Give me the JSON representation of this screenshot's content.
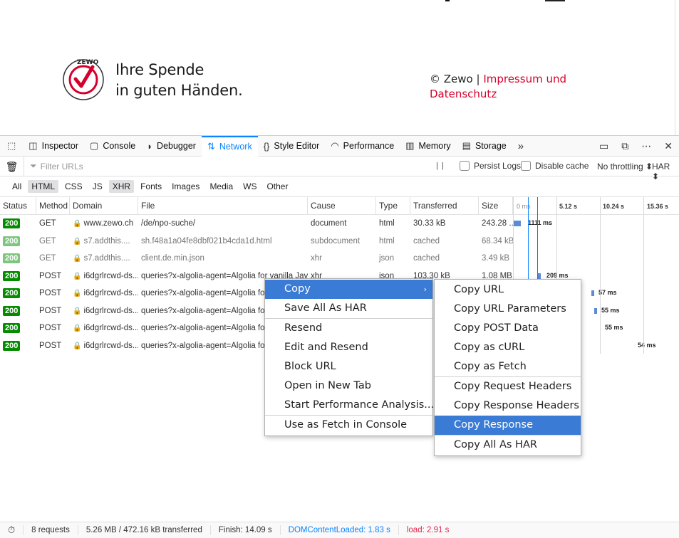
{
  "page": {
    "logo_text_line1": "Ihre Spende",
    "logo_text_line2": "in guten Händen.",
    "logo_seal_text": "ZEWO",
    "copyright": "© Zewo | ",
    "impressum_link": "Impressum und",
    "datenschutz_link": "Datenschutz"
  },
  "toolbar": {
    "tabs": [
      {
        "label": "Inspector",
        "icon": "inspector-icon"
      },
      {
        "label": "Console",
        "icon": "console-icon"
      },
      {
        "label": "Debugger",
        "icon": "debugger-icon"
      },
      {
        "label": "Network",
        "icon": "network-icon"
      },
      {
        "label": "Style Editor",
        "icon": "style-editor-icon"
      },
      {
        "label": "Performance",
        "icon": "performance-icon"
      },
      {
        "label": "Memory",
        "icon": "memory-icon"
      },
      {
        "label": "Storage",
        "icon": "storage-icon"
      }
    ],
    "active": "Network"
  },
  "filter": {
    "placeholder": "Filter URLs",
    "persist_logs": "Persist Logs",
    "disable_cache": "Disable cache",
    "throttling": "No throttling ⬍",
    "har": "HAR ⬍"
  },
  "types": [
    "All",
    "HTML",
    "CSS",
    "JS",
    "XHR",
    "Fonts",
    "Images",
    "Media",
    "WS",
    "Other"
  ],
  "columns": [
    "Status",
    "Method",
    "Domain",
    "File",
    "Cause",
    "Type",
    "Transferred",
    "Size"
  ],
  "waterfall_ticks": [
    "0 ms",
    "5.12 s",
    "10.24 s",
    "15.36 s"
  ],
  "rows": [
    {
      "status": "200",
      "method": "GET",
      "domain": "www.zewo.ch",
      "file": "/de/npo-suche/",
      "cause": "document",
      "type": "html",
      "transferred": "30.33 kB",
      "size": "243.28 ...",
      "wf": "1111 ms",
      "cached": false
    },
    {
      "status": "200",
      "method": "GET",
      "domain": "s7.addthis....",
      "file": "sh.f48a1a04fe8dbf021b4cda1d.html",
      "cause": "subdocument",
      "type": "html",
      "transferred": "cached",
      "size": "68.34 kB",
      "wf": "",
      "cached": true
    },
    {
      "status": "200",
      "method": "GET",
      "domain": "s7.addthis....",
      "file": "client.de.min.json",
      "cause": "xhr",
      "type": "json",
      "transferred": "cached",
      "size": "3.49 kB",
      "wf": "",
      "cached": true
    },
    {
      "status": "200",
      "method": "POST",
      "domain": "i6dgrlrcwd-ds...",
      "file": "queries?x-algolia-agent=Algolia for vanilla Jav...",
      "cause": "xhr",
      "type": "json",
      "transferred": "103.30 kB",
      "size": "1.08 MB",
      "wf": "209 ms",
      "cached": false
    },
    {
      "status": "200",
      "method": "POST",
      "domain": "i6dgrlrcwd-ds...",
      "file": "queries?x-algolia-agent=Algolia for",
      "cause": "",
      "type": "",
      "transferred": "",
      "size": "",
      "wf": "57 ms",
      "cached": false
    },
    {
      "status": "200",
      "method": "POST",
      "domain": "i6dgrlrcwd-ds...",
      "file": "queries?x-algolia-agent=Algolia for",
      "cause": "",
      "type": "",
      "transferred": "",
      "size": "",
      "wf": "55 ms",
      "cached": false
    },
    {
      "status": "200",
      "method": "POST",
      "domain": "i6dgrlrcwd-ds...",
      "file": "queries?x-algolia-agent=Algolia for",
      "cause": "",
      "type": "",
      "transferred": "",
      "size": "",
      "wf": "55 ms",
      "cached": false
    },
    {
      "status": "200",
      "method": "POST",
      "domain": "i6dgrlrcwd-ds...",
      "file": "queries?x-algolia-agent=Algolia for",
      "cause": "",
      "type": "",
      "transferred": "",
      "size": "",
      "wf": "54 ms",
      "cached": false
    }
  ],
  "statusbar": {
    "requests": "8 requests",
    "transferred": "5.26 MB / 472.16 kB transferred",
    "finish": "Finish: 14.09 s",
    "dom": "DOMContentLoaded: 1.83 s",
    "load": "load: 2.91 s"
  },
  "context_menu": {
    "items": [
      "Copy",
      "Save All As HAR",
      "Resend",
      "Edit and Resend",
      "Block URL",
      "Open in New Tab",
      "Start Performance Analysis...",
      "Use as Fetch in Console"
    ]
  },
  "copy_submenu": {
    "items": [
      "Copy URL",
      "Copy URL Parameters",
      "Copy POST Data",
      "Copy as cURL",
      "Copy as Fetch",
      "Copy Request Headers",
      "Copy Response Headers",
      "Copy Response",
      "Copy All As HAR"
    ],
    "highlighted": "Copy Response"
  }
}
